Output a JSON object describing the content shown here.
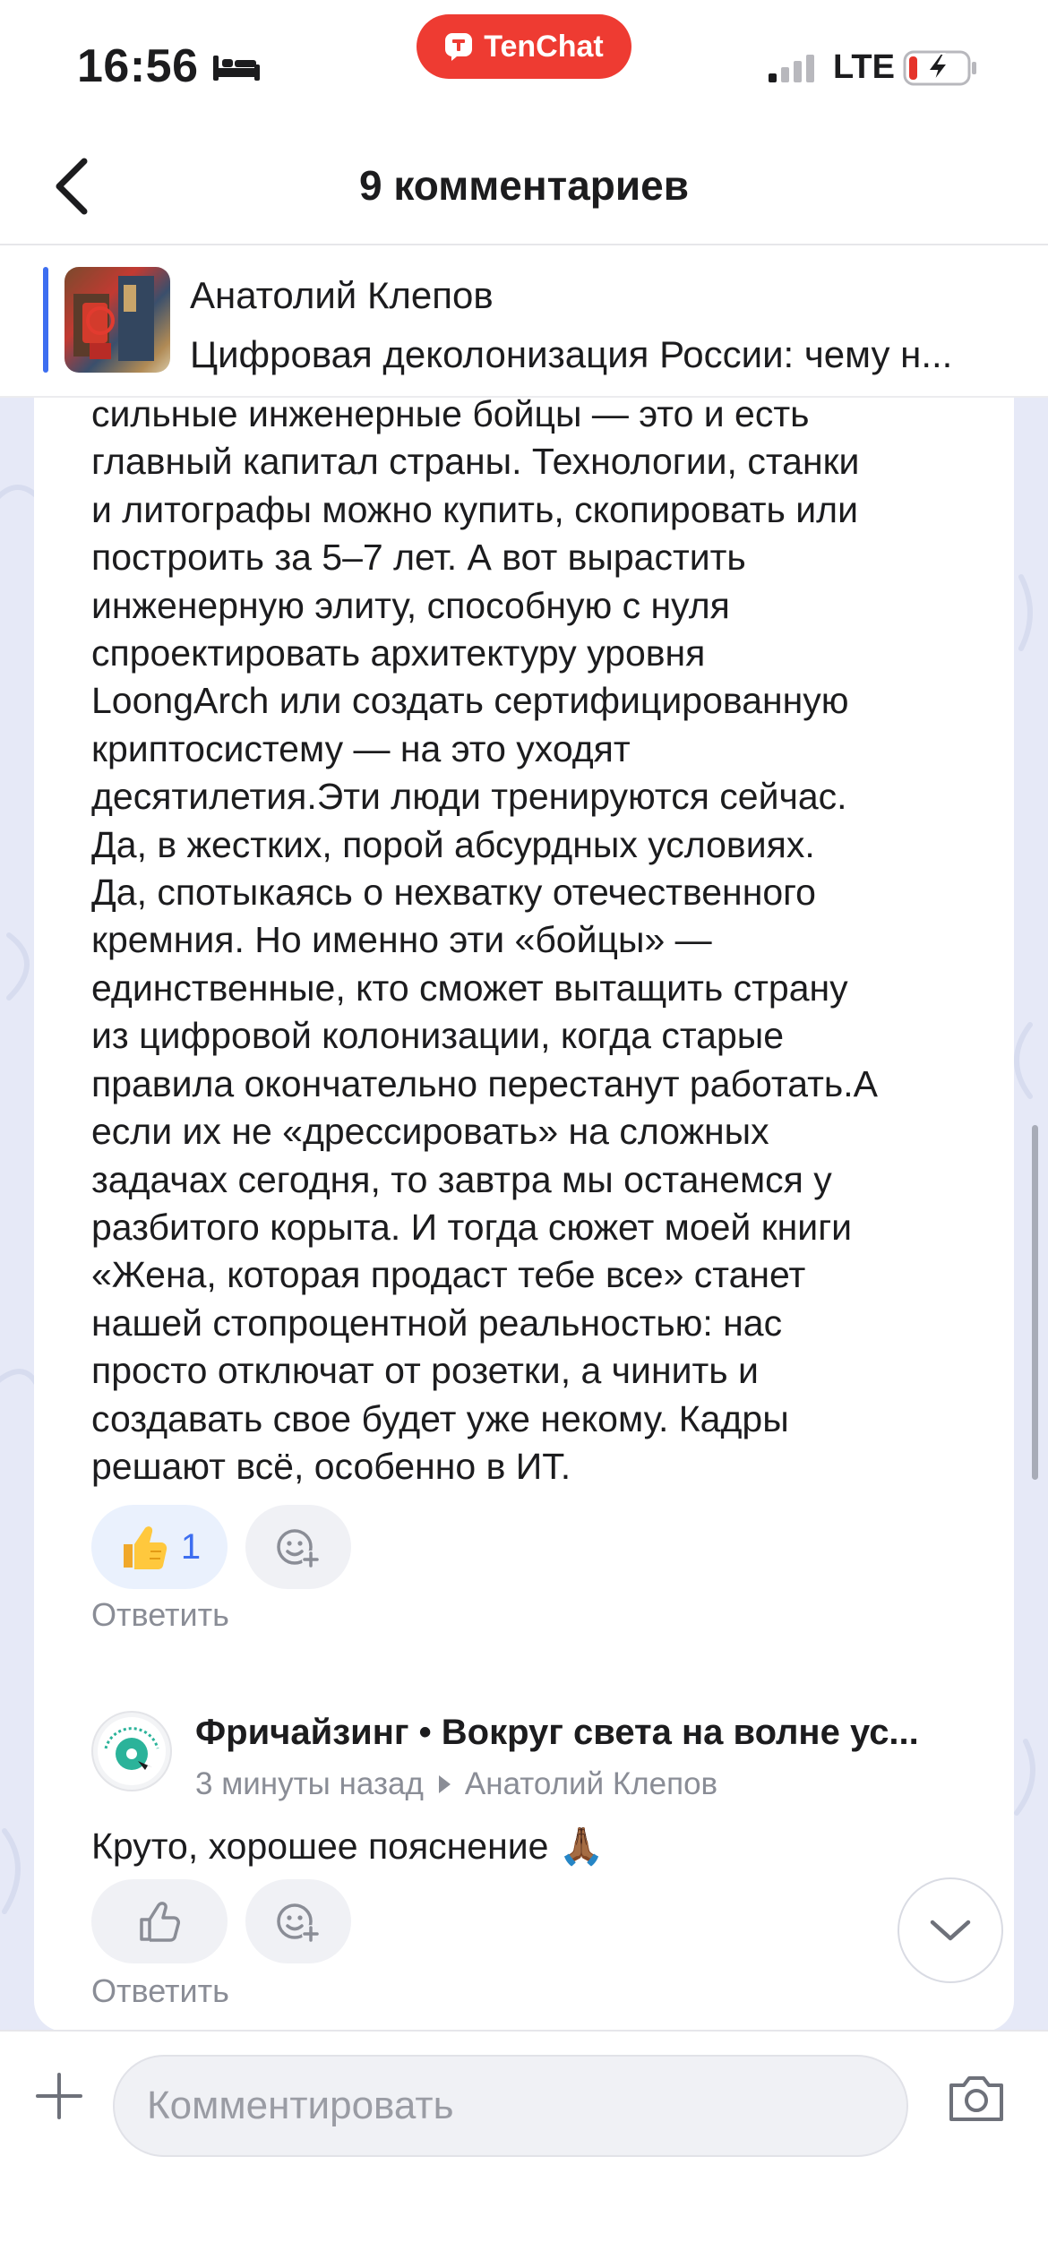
{
  "status_bar": {
    "time": "16:56",
    "network": "LTE",
    "app_pill": "TenChat"
  },
  "header": {
    "title": "9  комментариев"
  },
  "post": {
    "author": "Анатолий Клепов",
    "title": "Цифровая деколонизация России: чему н..."
  },
  "comment": {
    "lines": [
      "сильные инженерные бойцы — это и есть",
      "главный капитал страны. Технологии, станки",
      "и литографы можно купить, скопировать или",
      "построить за 5–7 лет. А вот вырастить",
      "инженерную элиту, способную с нуля",
      "спроектировать архитектуру уровня",
      "LoongArch или создать сертифицированную",
      "криптосистему — на это уходят",
      "десятилетия.Эти люди тренируются сейчас.",
      "Да, в жестких, порой абсурдных условиях.",
      "Да, спотыкаясь о нехватку отечественного",
      "кремния. Но именно эти «бойцы» —",
      "единственные, кто сможет вытащить страну",
      "из цифровой колонизации, когда старые",
      "правила окончательно перестанут работать.А",
      "если их не «дрессировать» на сложных",
      "задачах сегодня, то завтра мы останемся у",
      "разбитого корыта. И тогда сюжет моей книги",
      "«Жена, которая продаст тебе все» станет",
      "нашей стопроцентной реальностью: нас",
      "просто отключат от розетки, а чинить и",
      "создавать свое будет уже некому. Кадры",
      "решают всё, особенно в ИТ."
    ],
    "like_count": "1",
    "reply_label": "Ответить"
  },
  "reply": {
    "author": "Фричайзинг • Вокруг света на волне ус...",
    "time": "3 минуты назад",
    "reply_to": "Анатолий Клепов",
    "text": "Круто, хорошее пояснение 🙏🏾",
    "reply_label": "Ответить"
  },
  "input": {
    "placeholder": "Комментировать"
  },
  "colors": {
    "accent": "#3d6ef0",
    "brand": "#ee3b32",
    "background": "#e6e9f7"
  }
}
